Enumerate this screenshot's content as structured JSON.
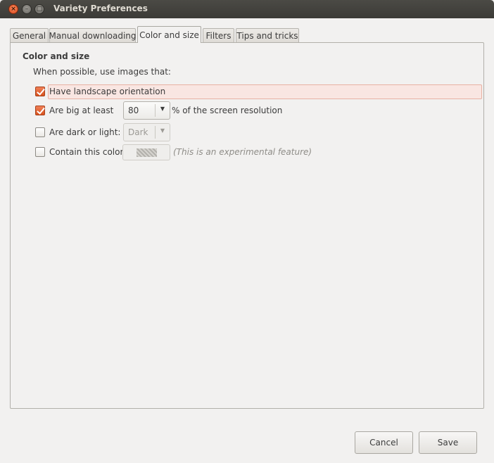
{
  "window": {
    "title": "Variety Preferences",
    "controls": {
      "close": "×",
      "minimize": "–",
      "maximize": "□"
    }
  },
  "tabs": [
    {
      "label": "General"
    },
    {
      "label": "Manual downloading"
    },
    {
      "label": "Color and size",
      "active": true
    },
    {
      "label": "Filters"
    },
    {
      "label": "Tips and tricks"
    }
  ],
  "section": {
    "title": "Color and size",
    "intro": "When possible, use images that:"
  },
  "options": {
    "landscape": {
      "label": "Have landscape orientation",
      "checked": true
    },
    "big": {
      "label": "Are big at least",
      "checked": true,
      "value": "80",
      "suffix": "% of the screen resolution"
    },
    "dark": {
      "label": "Are dark or light:",
      "checked": false,
      "value": "Dark"
    },
    "color": {
      "label": "Contain this color:",
      "checked": false,
      "note": "(This is an experimental feature)"
    }
  },
  "buttons": {
    "cancel": "Cancel",
    "save": "Save"
  },
  "colors": {
    "accent": "#dd4814",
    "highlight": "#f9e6e2"
  }
}
